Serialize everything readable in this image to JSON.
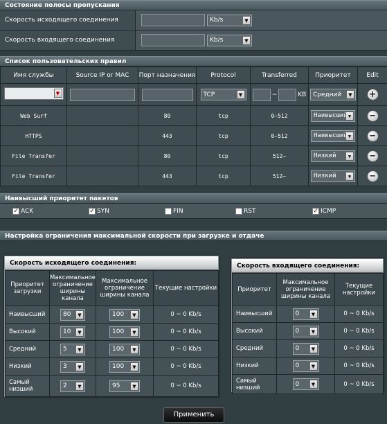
{
  "bandwidth": {
    "title": "Состояние полосы пропускания",
    "upload_label": "Скорость исходящего соединения",
    "download_label": "Скорость входящего соединения",
    "unit": "Kb/s"
  },
  "rules": {
    "title": "Список пользовательских правил",
    "headers": [
      "Имя службы",
      "Source IP or MAC",
      "Порт назначения",
      "Protocol",
      "Transferred",
      "Приоритет",
      "Edit"
    ],
    "new_rule": {
      "protocol": "TCP",
      "range_sep": "~",
      "unit": "KB",
      "priority": "Средний"
    },
    "rows": [
      {
        "service": "Web Surf",
        "source": "",
        "port": "80",
        "protocol": "tcp",
        "transferred": "0~512",
        "priority": "Наивысший"
      },
      {
        "service": "HTTPS",
        "source": "",
        "port": "443",
        "protocol": "tcp",
        "transferred": "0~512",
        "priority": "Наивысший"
      },
      {
        "service": "File Transfer",
        "source": "",
        "port": "80",
        "protocol": "tcp",
        "transferred": "512~",
        "priority": "Низкий"
      },
      {
        "service": "File Transfer",
        "source": "",
        "port": "443",
        "protocol": "tcp",
        "transferred": "512~",
        "priority": "Низкий"
      }
    ]
  },
  "packets": {
    "title": "Наивысший приоритет пакетов",
    "flags": [
      {
        "label": "ACK",
        "checked": true
      },
      {
        "label": "SYN",
        "checked": true
      },
      {
        "label": "FIN",
        "checked": false
      },
      {
        "label": "RST",
        "checked": false
      },
      {
        "label": "ICMP",
        "checked": true
      }
    ]
  },
  "limits": {
    "title": "Настройка ограничения максимальной скорости при загрузке и отдаче",
    "upload": {
      "title": "Скорость исходящего соединения:",
      "headers": [
        "Приоритет загрузки",
        "Максимальное ограничение ширины канала",
        "Максимальное ограничение ширины канала",
        "Текущие настройки"
      ],
      "rows": [
        {
          "priority": "Наивысший",
          "min": "80",
          "max": "100",
          "current": "0 ~ 0 Kb/s"
        },
        {
          "priority": "Высокий",
          "min": "10",
          "max": "100",
          "current": "0 ~ 0 Kb/s"
        },
        {
          "priority": "Средний",
          "min": "5",
          "max": "100",
          "current": "0 ~ 0 Kb/s"
        },
        {
          "priority": "Низкий",
          "min": "3",
          "max": "100",
          "current": "0 ~ 0 Kb/s"
        },
        {
          "priority": "Самый низший",
          "min": "2",
          "max": "95",
          "current": "0 ~ 0 Kb/s"
        }
      ]
    },
    "download": {
      "title": "Скорость входящего соединения:",
      "headers": [
        "Приоритет",
        "Максимальное ограничение ширины канала",
        "Текущие настройки"
      ],
      "rows": [
        {
          "priority": "Наивысший",
          "max": "0",
          "current": "0 ~ 0 Kb/s"
        },
        {
          "priority": "Высокий",
          "max": "0",
          "current": "0 ~ 0 Kb/s"
        },
        {
          "priority": "Средний",
          "max": "0",
          "current": "0 ~ 0 Kb/s"
        },
        {
          "priority": "Низкий",
          "max": "0",
          "current": "0 ~ 0 Kb/s"
        },
        {
          "priority": "Самый низший",
          "max": "0",
          "current": "0 ~ 0 Kb/s"
        }
      ]
    }
  },
  "apply_label": "Применить"
}
